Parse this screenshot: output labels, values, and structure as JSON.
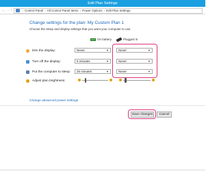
{
  "window": {
    "title": "Edit Plan Settings"
  },
  "address_bar": {
    "crumbs": [
      "Control Panel",
      "All Control Panel Items",
      "Power Options",
      "Edit Plan Settings"
    ],
    "separator": "›"
  },
  "page": {
    "heading": "Change settings for the plan: My Custom Plan 1",
    "subheading": "Choose the sleep and display settings that you want your computer to use."
  },
  "columns": {
    "battery": "On battery",
    "plugged": "Plugged in"
  },
  "settings": [
    {
      "label": "Dim the display:",
      "battery": "Never",
      "plugged": "Never",
      "icon": "dim-display-icon",
      "color": "#f2a634"
    },
    {
      "label": "Turn off the display:",
      "battery": "5 minutes",
      "plugged": "Never",
      "icon": "display-icon",
      "color": "#4b8fd6"
    },
    {
      "label": "Put the computer to sleep:",
      "battery": "25 minutes",
      "plugged": "Never",
      "icon": "sleep-icon",
      "color": "#5a7fae"
    }
  ],
  "brightness": {
    "label": "Adjust plan brightness:",
    "battery_level": 0.1,
    "plugged_level": 0.05
  },
  "links": {
    "advanced": "Change advanced power settings"
  },
  "buttons": {
    "save": "Save changes",
    "cancel": "Cancel"
  },
  "colors": {
    "titlebar": "#1aa0e0",
    "link": "#1a66b8",
    "highlight": "#d9357a"
  }
}
